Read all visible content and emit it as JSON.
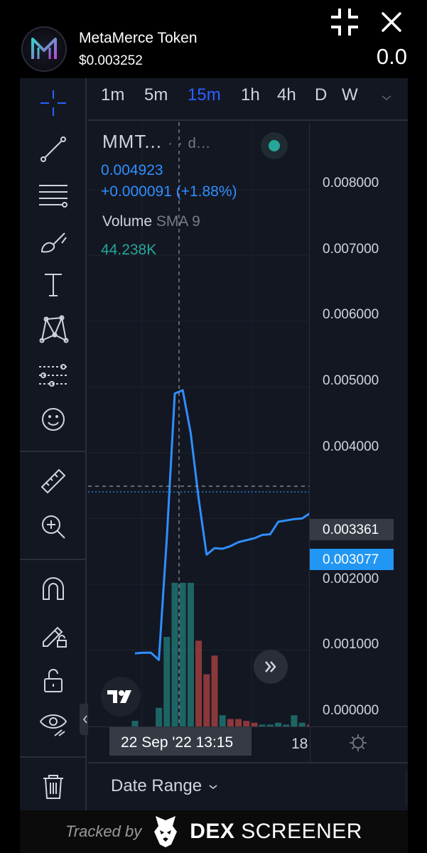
{
  "header": {
    "token_name": "MetaMerce Token",
    "token_price": "$0.003252",
    "value": "0.0",
    "collapse_icon": "collapse-icon",
    "close_icon": "close-icon"
  },
  "intervals": [
    "1m",
    "5m",
    "15m",
    "1h",
    "4h",
    "D",
    "W"
  ],
  "active_interval": "15m",
  "legend": {
    "symbol": "MMT...",
    "symbol_suffix": "· ·  d...",
    "price": "0.004923",
    "change": "+0.000091 (+1.88%)",
    "volume_label": "Volume",
    "volume_sma": "SMA 9",
    "volume_value": "44.238K"
  },
  "price_axis": {
    "ticks": [
      "0.008000",
      "0.007000",
      "0.006000",
      "0.005000",
      "0.004000",
      "0.002000",
      "0.001000",
      "0.000000"
    ],
    "crosshair_price": "0.003361",
    "last_price": "0.003077"
  },
  "time_axis": {
    "crosshair_time": "22 Sep '22   13:15",
    "tick": "18"
  },
  "bottom": {
    "date_range": "Date Range"
  },
  "footer": {
    "tracked_by": "Tracked by",
    "brand_bold": "DEX",
    "brand_rest": "SCREENER"
  },
  "colors": {
    "background": "#131722",
    "accent": "#2962ff",
    "line": "#2f8fff",
    "up": "#26a69a",
    "down": "#ef5350"
  },
  "chart_data": {
    "type": "line",
    "title": "",
    "series": [
      {
        "values": [
          0.00095,
          0.00096,
          0.00096,
          0.00085,
          0.0027,
          0.0049,
          0.00495,
          0.0043,
          0.0033,
          0.00245,
          0.00255,
          0.00254,
          0.00258,
          0.00264,
          0.00267,
          0.0027,
          0.00275,
          0.00276,
          0.00295,
          0.00297,
          0.00299,
          0.003,
          0.00308
        ]
      }
    ],
    "volume": {
      "values": [
        0.3,
        0.0,
        0.0,
        1.0,
        4.8,
        7.7,
        7.7,
        7.7,
        4.6,
        2.8,
        3.8,
        0.6,
        0.4,
        0.4,
        0.3,
        0.2,
        0.1,
        0.1,
        0.2,
        0.1,
        0.6,
        0.2,
        0.1
      ],
      "up": [
        true,
        true,
        true,
        true,
        true,
        true,
        true,
        true,
        false,
        false,
        false,
        true,
        false,
        false,
        false,
        false,
        true,
        true,
        true,
        true,
        true,
        true,
        false
      ]
    },
    "ylim": [
      0.0,
      0.0087
    ],
    "grid": true
  }
}
